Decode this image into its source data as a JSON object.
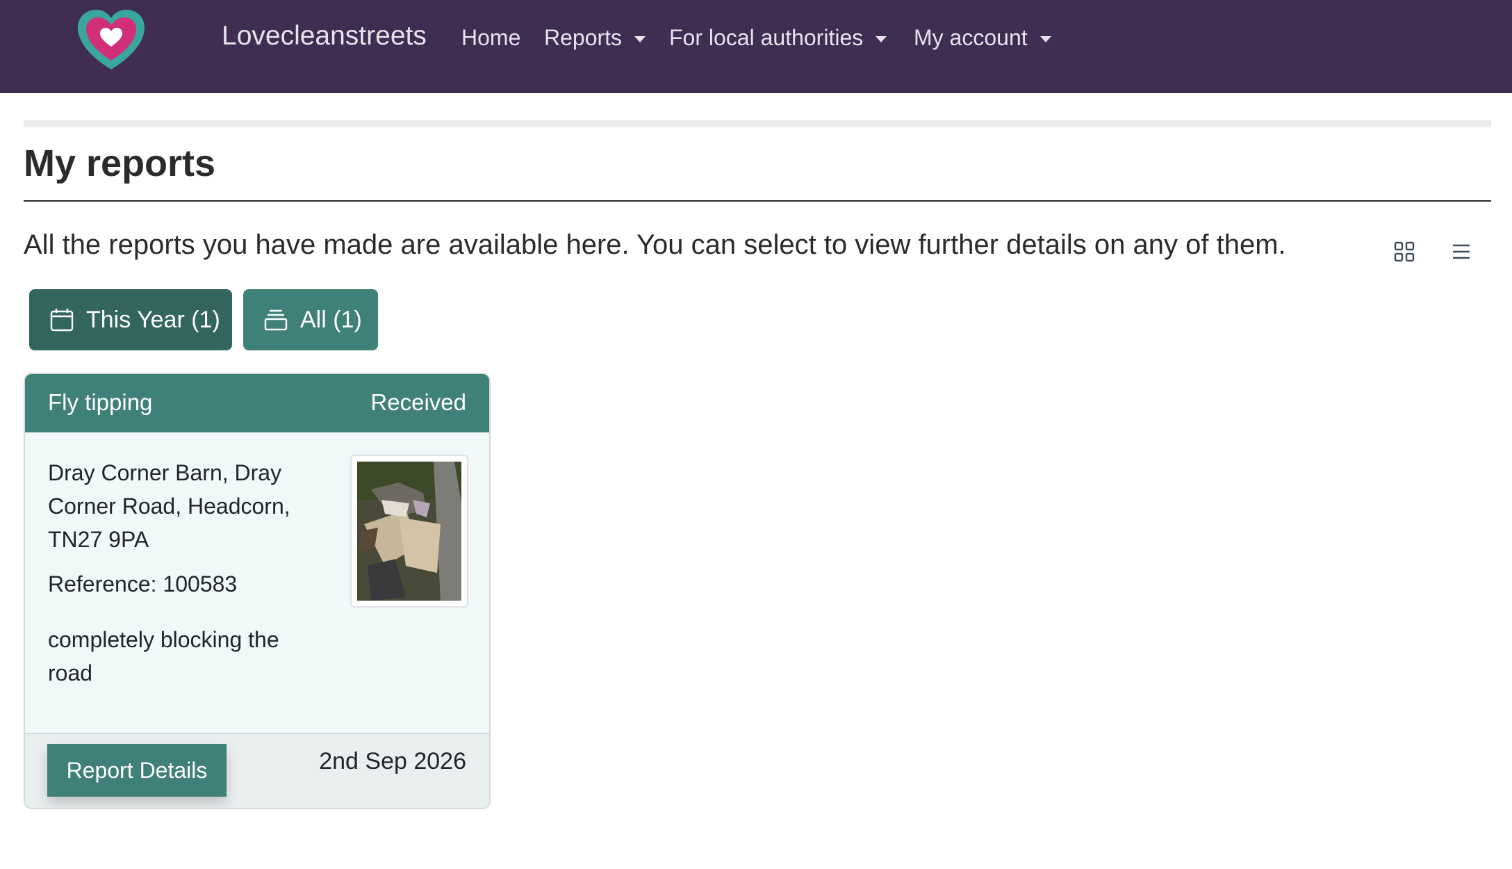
{
  "app": {
    "brand": "Lovecleanstreets"
  },
  "nav": {
    "items": [
      {
        "label": "Home",
        "dropdown": false
      },
      {
        "label": "Reports",
        "dropdown": true
      },
      {
        "label": "For local authorities",
        "dropdown": true
      },
      {
        "label": "My account",
        "dropdown": true
      }
    ]
  },
  "page": {
    "title": "My reports",
    "intro": "All the reports you have made are available here. You can select to view further details on any of them.",
    "view_options": [
      "grid-icon",
      "list-icon"
    ]
  },
  "filters": [
    {
      "label": "This Year (1)",
      "icon": "calendar-icon",
      "active": true
    },
    {
      "label": "All (1)",
      "icon": "stack-icon",
      "active": false
    }
  ],
  "reports": [
    {
      "category": "Fly tipping",
      "status": "Received",
      "address": "Dray Corner Barn, Dray Corner Road, Headcorn, TN27 9PA",
      "reference": "Reference: 100583",
      "description": "completely blocking the road",
      "details_label": "Report Details",
      "date": "2nd Sep 2026"
    }
  ],
  "colors": {
    "navbar": "#3f2d52",
    "accent": "#3f8079",
    "accent_dark": "#33665f",
    "logo_outer": "#3aa79f",
    "logo_inner": "#d12f78",
    "card_body": "#f1f8f8"
  }
}
